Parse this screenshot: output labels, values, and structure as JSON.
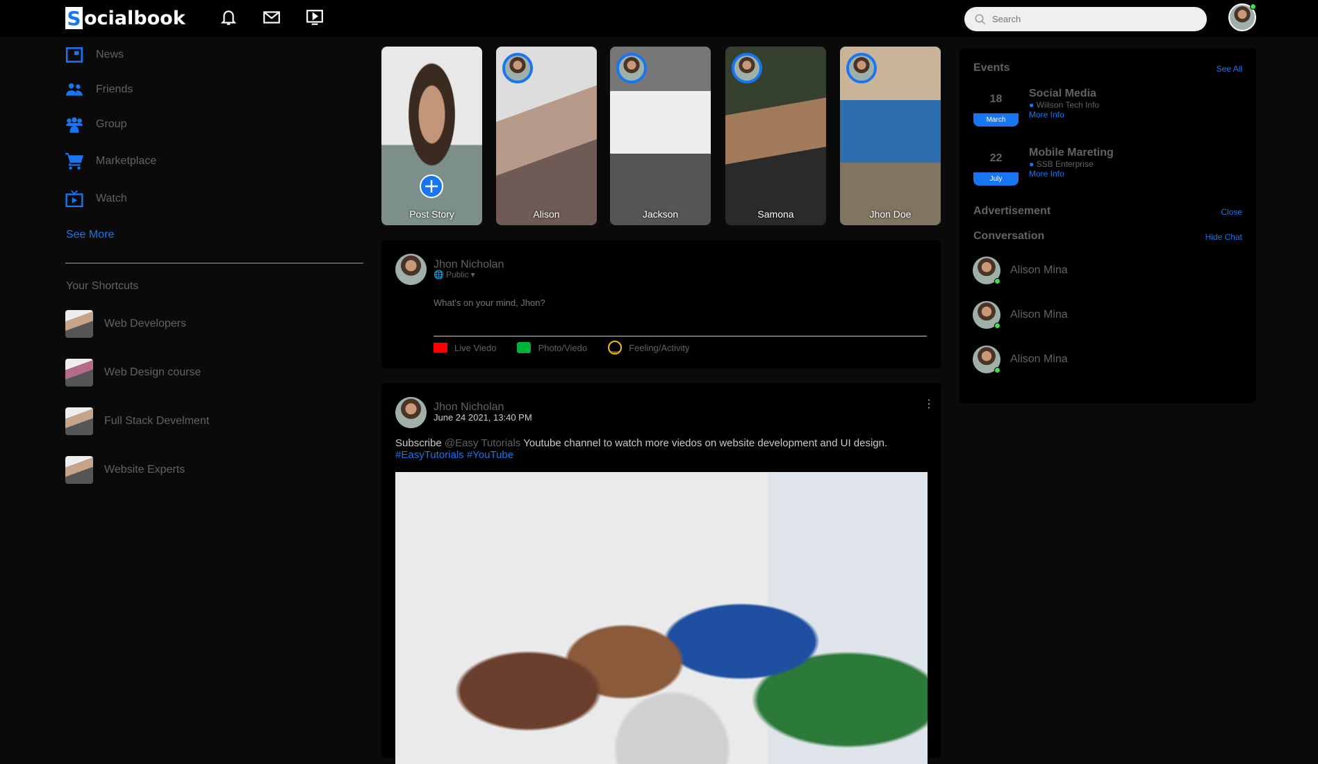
{
  "nav": {
    "logo_letter": "S",
    "logo_rest": "ocialbook",
    "icons": [
      "bell-icon",
      "mail-icon",
      "video-icon"
    ],
    "search_placeholder": "Search"
  },
  "sidebar": {
    "items": [
      {
        "label": "News",
        "icon": "news-icon"
      },
      {
        "label": "Friends",
        "icon": "friends-icon"
      },
      {
        "label": "Group",
        "icon": "group-icon"
      },
      {
        "label": "Marketplace",
        "icon": "cart-icon"
      },
      {
        "label": "Watch",
        "icon": "tv-icon"
      }
    ],
    "see_more": "See More",
    "shortcuts_title": "Your Shortcuts",
    "shortcuts": [
      "Web Developers",
      "Web Design course",
      "Full Stack Develment",
      "Website Experts"
    ]
  },
  "stories": [
    {
      "name": "Post Story"
    },
    {
      "name": "Alison"
    },
    {
      "name": "Jackson"
    },
    {
      "name": "Samona"
    },
    {
      "name": "Jhon Doe"
    }
  ],
  "create_post": {
    "user": "Jhon Nicholan",
    "privacy": "Public",
    "placeholder": "What's on your mind, Jhon?",
    "actions": [
      {
        "label": "Live Viedo",
        "color": "#ff0000"
      },
      {
        "label": "Photo/Viedo",
        "color": "#00b13b"
      },
      {
        "label": "Feeling/Activity",
        "color": "#f2c200"
      }
    ]
  },
  "post": {
    "user": "Jhon Nicholan",
    "time": "June 24 2021, 13:40 PM",
    "text_before": "Subscribe ",
    "mention": "@Easy Tutorials",
    "text_after": " Youtube channel to watch more viedos on website development and UI design.",
    "hashtags": "#EasyTutorials #YouTube"
  },
  "right": {
    "events_title": "Events",
    "see_all": "See All",
    "events": [
      {
        "day": "18",
        "month": "March",
        "title": "Social Media",
        "place": "Willson Tech Info",
        "more": "More Info"
      },
      {
        "day": "22",
        "month": "July",
        "title": "Mobile Mareting",
        "place": "SSB Enterprise",
        "more": "More Info"
      }
    ],
    "ad_title": "Advertisement",
    "ad_close": "Close",
    "conv_title": "Conversation",
    "hide_chat": "Hide Chat",
    "chats": [
      "Alison Mina",
      "Alison Mina",
      "Alison Mina"
    ]
  },
  "colors": {
    "accent": "#1876f2",
    "online": "#41db51"
  }
}
